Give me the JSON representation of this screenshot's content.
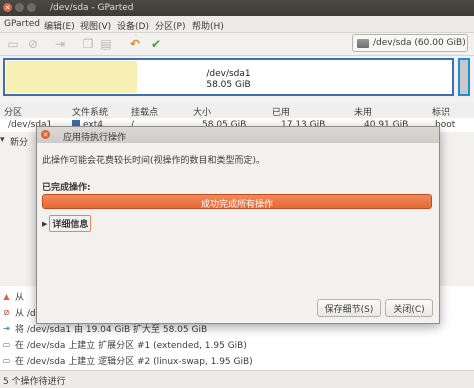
{
  "window": {
    "title": "/dev/sda - GParted"
  },
  "menu": [
    "GParted",
    "编辑(E)",
    "视图(V)",
    "设备(D)",
    "分区(P)",
    "帮助(H)"
  ],
  "device_selector": "/dev/sda  (60.00 GiB)",
  "diskmap": {
    "partition": "/dev/sda1",
    "size": "58.05 GiB"
  },
  "columns": [
    "分区",
    "文件系统",
    "挂载点",
    "大小",
    "已用",
    "未用",
    "标识"
  ],
  "rows": [
    {
      "partition": "/dev/sda1",
      "filesystem": "ext4",
      "mount": "/",
      "size": "58.05 GiB",
      "used": "17.13 GiB",
      "unused": "40.91 GiB",
      "flags": "boot"
    },
    {
      "partition": "新分"
    }
  ],
  "dialog": {
    "title": "应用待执行操作",
    "message": "此操作可能会花费较长时间(视操作的数目和类型而定)。",
    "completed_label": "已完成操作:",
    "progress_text": "成功完成所有操作",
    "progress": 1.0,
    "details_label": "详细信息",
    "save_details": "保存细节(S)",
    "close": "关闭(C)"
  },
  "operations": [
    {
      "icon": "warning",
      "text": "从"
    },
    {
      "icon": "delete",
      "text": "从 /dev"
    },
    {
      "icon": "resize",
      "text": "将 /dev/sda1 由 19.04 GiB 扩大至 58.05 GiB"
    },
    {
      "icon": "new",
      "text": "在 /dev/sda 上建立 扩展分区 #1 (extended, 1.95 GiB)"
    },
    {
      "icon": "new",
      "text": "在 /dev/sda 上建立 逻辑分区 #2 (linux-swap, 1.95 GiB)"
    }
  ],
  "status": "5 个操作待进行",
  "colors": {
    "accent": "#e46a35",
    "used": "#f6f0b5",
    "ext4": "#3b6ea5"
  }
}
